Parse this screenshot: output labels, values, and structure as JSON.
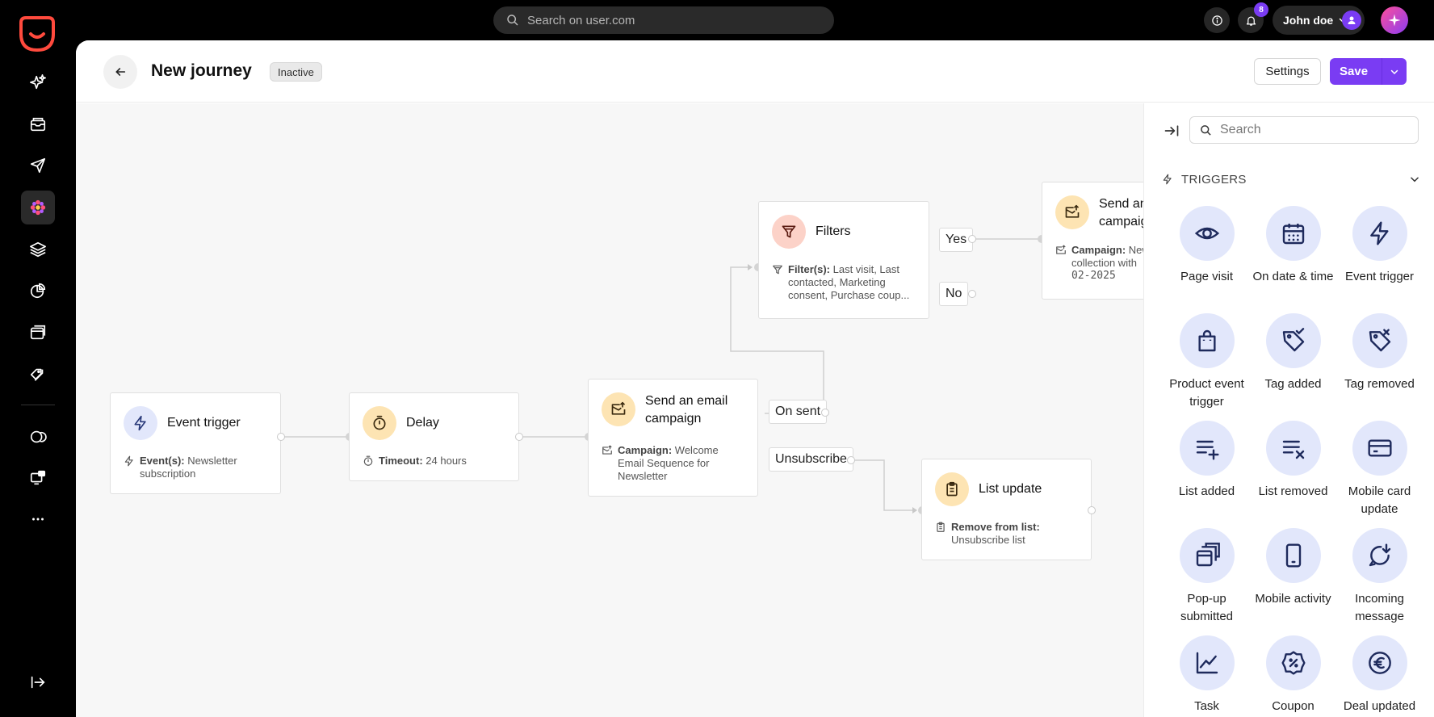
{
  "topbar": {
    "search_placeholder": "Search on user.com",
    "notification_count": "8",
    "user_name": "John doe"
  },
  "rail": {
    "items": [
      "sparkles-icon",
      "inbox-icon",
      "send-icon",
      "automation-icon",
      "layers-icon",
      "analytics-icon",
      "window-icon",
      "tags-icon",
      "chat-bubbles-icon",
      "screen-chat-icon",
      "more-icon"
    ],
    "active": "automation-icon"
  },
  "header": {
    "title": "New journey",
    "status": "Inactive",
    "settings_label": "Settings",
    "save_label": "Save"
  },
  "colors": {
    "accent": "#7a3cf3",
    "trigger_icon_bg": "#e2e7fb",
    "action_icon_bg": "#fde4b3",
    "filter_icon_bg": "#fcd2c8"
  },
  "canvas": {
    "nodes": {
      "event_trigger": {
        "title": "Event trigger",
        "desc_key": "Event(s):",
        "desc_value": "Newsletter subscription"
      },
      "delay": {
        "title": "Delay",
        "desc_key": "Timeout:",
        "desc_value": "24 hours"
      },
      "send_email": {
        "title": "Send an email campaign",
        "desc_key": "Campaign:",
        "desc_value": "Welcome Email Sequence for Newsletter"
      },
      "filters": {
        "title": "Filters",
        "desc_key": "Filter(s):",
        "desc_value": "Last visit, Last contacted, Marketing consent, Purchase coup..."
      },
      "send_email_2": {
        "title": "Send an email campaign",
        "desc_key": "Campaign:",
        "desc_value": "New collection with",
        "desc_date": "02-2025"
      },
      "list_update": {
        "title": "List update",
        "desc_key": "Remove from list:",
        "desc_value": "Unsubscribe list"
      }
    },
    "edge_labels": {
      "on_sent": "On sent",
      "unsubscribe": "Unsubscribe",
      "yes": "Yes",
      "no": "No"
    }
  },
  "sidebar": {
    "search_placeholder": "Search",
    "section_title": "TRIGGERS",
    "triggers": [
      {
        "label": "Page visit",
        "icon": "eye-icon"
      },
      {
        "label": "On date & time",
        "icon": "calendar-icon"
      },
      {
        "label": "Event trigger",
        "icon": "bolt-icon"
      },
      {
        "label": "Product event trigger",
        "icon": "shopping-bag-icon"
      },
      {
        "label": "Tag added",
        "icon": "tag-check-icon"
      },
      {
        "label": "Tag removed",
        "icon": "tag-remove-icon"
      },
      {
        "label": "List added",
        "icon": "list-add-icon"
      },
      {
        "label": "List removed",
        "icon": "list-remove-icon"
      },
      {
        "label": "Mobile card update",
        "icon": "card-icon"
      },
      {
        "label": "Pop-up submitted",
        "icon": "popup-icon"
      },
      {
        "label": "Mobile activity",
        "icon": "mobile-icon"
      },
      {
        "label": "Incoming message",
        "icon": "incoming-message-icon"
      },
      {
        "label": "Task",
        "icon": "chart-line-icon"
      },
      {
        "label": "Coupon",
        "icon": "coupon-icon"
      },
      {
        "label": "Deal updated",
        "icon": "euro-icon"
      }
    ]
  }
}
